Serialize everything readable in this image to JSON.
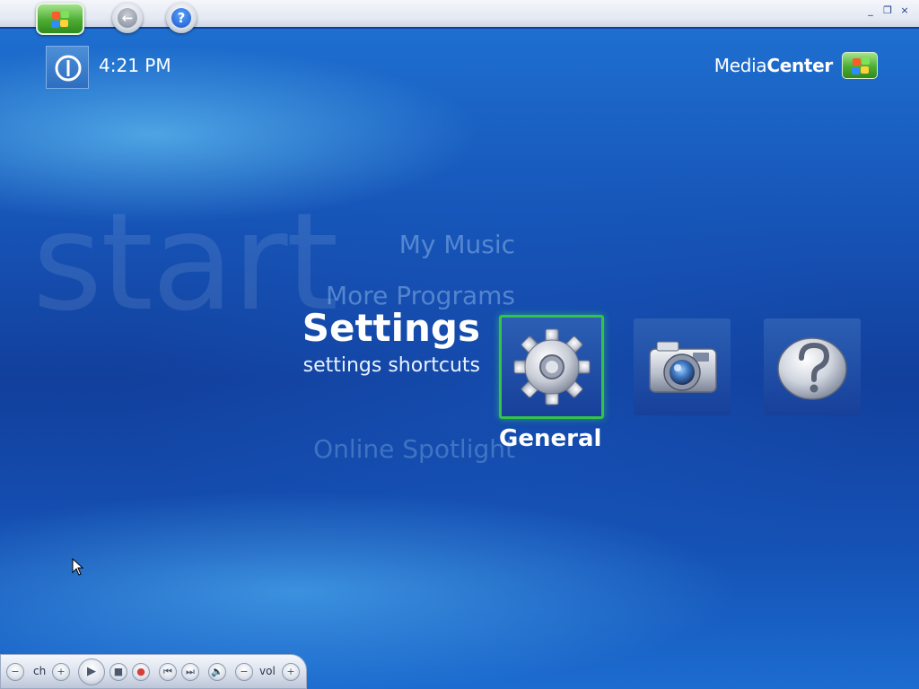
{
  "window": {
    "controls": {
      "minimize": "_",
      "restore": "❐",
      "close": "×"
    }
  },
  "nav": {
    "start_icon": "windows-flag-icon",
    "back_icon": "back-arrow-icon",
    "back_glyph": "←",
    "help_icon": "help-icon",
    "help_glyph": "?"
  },
  "status": {
    "power_icon": "power-icon",
    "clock": "4:21 PM"
  },
  "brand": {
    "name_light": "Media",
    "name_bold": "Center",
    "logo_icon": "windows-flag-icon"
  },
  "menu": {
    "watermark": "start",
    "items_above": [
      "My Music",
      "More Programs"
    ],
    "current": {
      "title": "Settings",
      "subtitle": "settings shortcuts"
    },
    "items_below": [
      "Online Spotlight"
    ],
    "tiles": [
      {
        "icon": "gear-icon",
        "label": "General",
        "selected": true
      },
      {
        "icon": "camera-icon",
        "label": "",
        "selected": false
      },
      {
        "icon": "help-icon",
        "label": "",
        "selected": false
      }
    ],
    "selected_label": "General"
  },
  "transport": {
    "channel_label": "ch",
    "volume_label": "vol",
    "buttons": [
      "minus",
      "plus",
      "play",
      "stop",
      "record",
      "skip-back",
      "skip-forward",
      "mute",
      "minus",
      "plus"
    ],
    "glyphs": {
      "minus": "−",
      "plus": "+",
      "play": "▶",
      "stop": "■",
      "record": "●",
      "skip_back": "⏮",
      "skip_forward": "⏭",
      "mute": "🔈"
    }
  },
  "colors": {
    "background": "#1756b9",
    "selection": "#34c24a",
    "tile": "#1f4da6",
    "text": "#ffffff"
  }
}
